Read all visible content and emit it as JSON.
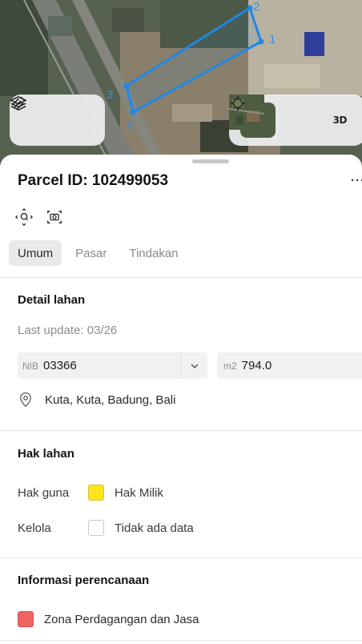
{
  "map": {
    "vertex_labels": [
      "1",
      "2",
      "3",
      "4"
    ],
    "layers_icon": "layers-icon",
    "draw_icon": "draw-line-icon",
    "locate_icon": "crosshair-icon",
    "view_3d_label": "3D"
  },
  "parcel": {
    "title": "Parcel ID: 102499053",
    "more_label": "···"
  },
  "tabs": [
    {
      "label": "Umum",
      "active": true
    },
    {
      "label": "Pasar",
      "active": false
    },
    {
      "label": "Tindakan",
      "active": false
    }
  ],
  "detail": {
    "title": "Detail lahan",
    "last_update": "Last update: 03/26",
    "nib_prefix": "NIB",
    "nib_value": "03366",
    "area_unit": "m2",
    "area_value": "794.0",
    "location": "Kuta, Kuta, Badung, Bali"
  },
  "hak": {
    "title": "Hak lahan",
    "rows": [
      {
        "key": "Hak guna",
        "value": "Hak Milik",
        "color": "#ffe51a"
      },
      {
        "key": "Kelola",
        "value": "Tidak ada data",
        "color": "#ffffff"
      }
    ]
  },
  "planning": {
    "title": "Informasi perencanaan",
    "zone": "Zona Perdagangan dan Jasa",
    "zone_color": "#ef6464"
  },
  "colors": {
    "parcel_outline": "#1e88e5",
    "accent_text": "#141414"
  }
}
